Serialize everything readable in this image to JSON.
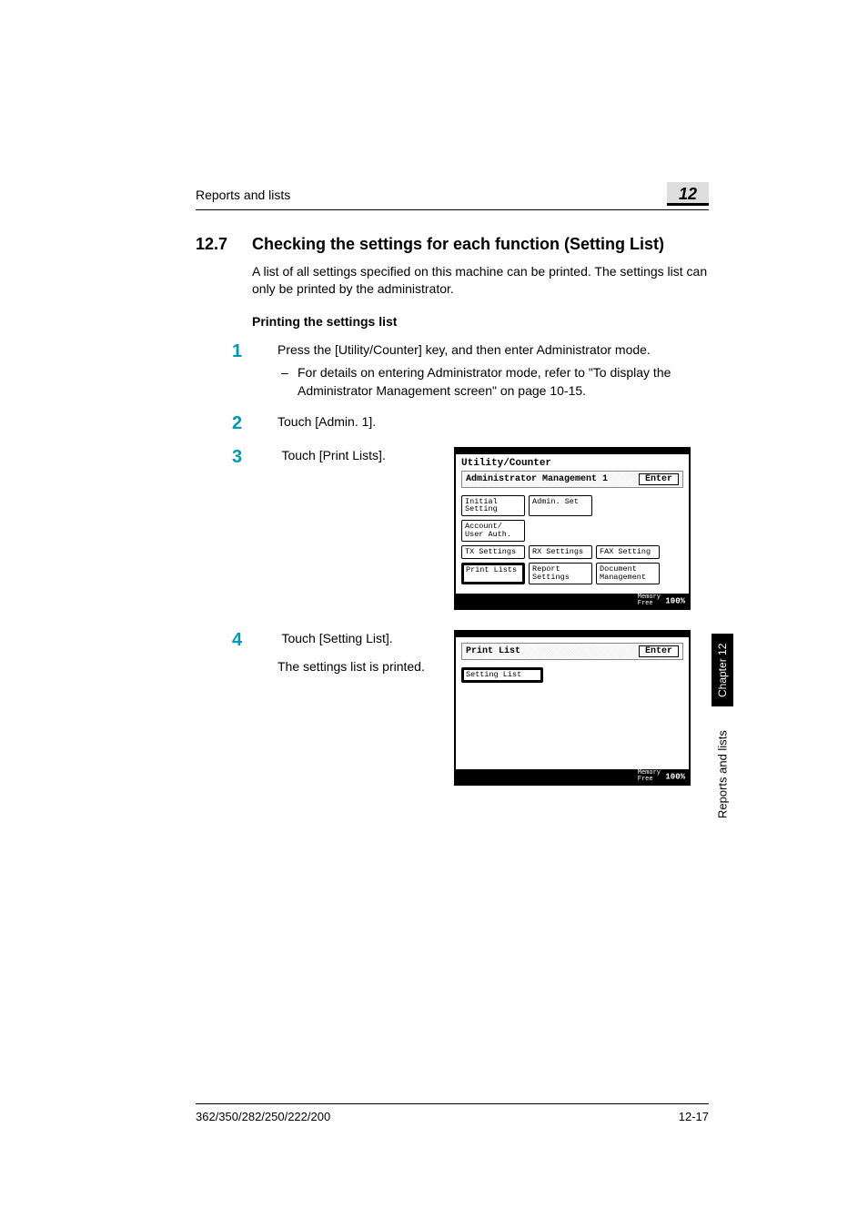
{
  "header": {
    "running_title": "Reports and lists",
    "chapter_number": "12"
  },
  "section": {
    "number": "12.7",
    "title": "Checking the settings for each function (Setting List)",
    "intro": "A list of all settings specified on this machine can be printed. The settings list can only be printed by the administrator."
  },
  "subhead": "Printing the settings list",
  "steps": {
    "s1": {
      "n": "1",
      "text": "Press the [Utility/Counter] key, and then enter Administrator mode.",
      "sub": "For details on entering Administrator mode, refer to \"To display the Administrator Management screen\" on page 10-15."
    },
    "s2": {
      "n": "2",
      "text": "Touch [Admin. 1]."
    },
    "s3": {
      "n": "3",
      "text": "Touch [Print Lists]."
    },
    "s4": {
      "n": "4",
      "text": "Touch [Setting List].",
      "follow": "The settings list is printed."
    }
  },
  "lcd1": {
    "title": "Utility/Counter",
    "subtitle": "Administrator Management 1",
    "enter": "Enter",
    "buttons": {
      "r1a": "Initial\nSetting",
      "r1b": "Admin. Set",
      "r2a": "Account/\nUser Auth.",
      "r3a": "TX Settings",
      "r3b": "RX Settings",
      "r3c": "FAX Setting",
      "r4a": "Print Lists",
      "r4b": "Report\nSettings",
      "r4c": "Document\nManagement"
    },
    "footer_label": "Memory\nFree",
    "footer_value": "100%"
  },
  "lcd2": {
    "title": "Print List",
    "enter": "Enter",
    "btn": "Setting List",
    "footer_label": "Memory\nFree",
    "footer_value": "100%"
  },
  "side": {
    "tab_dark": "Chapter 12",
    "tab_text": "Reports and lists"
  },
  "footer": {
    "left": "362/350/282/250/222/200",
    "right": "12-17"
  }
}
